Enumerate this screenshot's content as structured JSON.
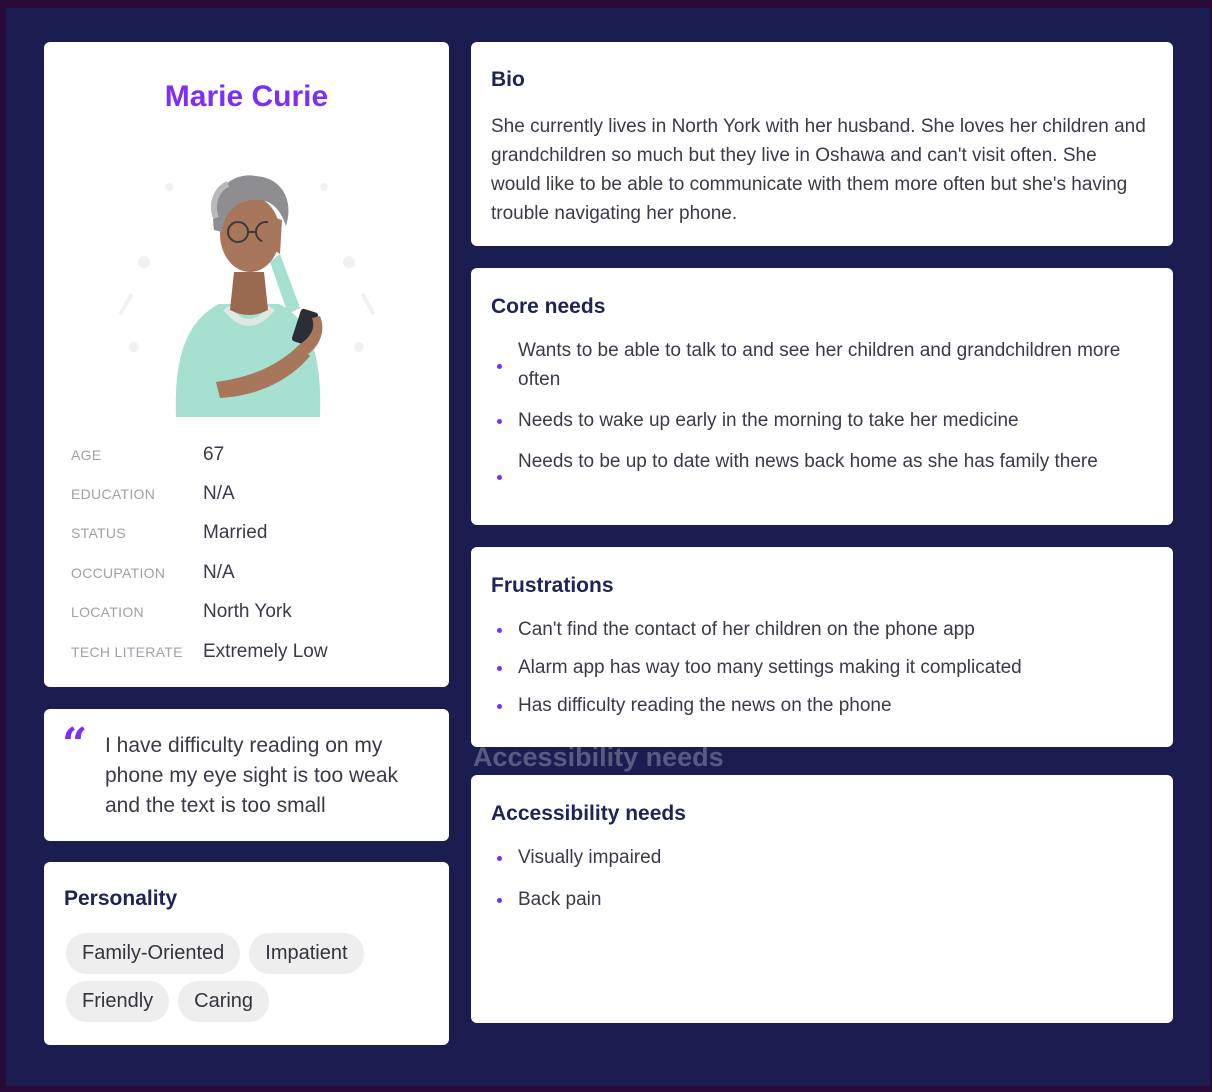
{
  "profile": {
    "name": "Marie Curie",
    "info": [
      {
        "label": "AGE",
        "value": "67"
      },
      {
        "label": "EDUCATION",
        "value": "N/A"
      },
      {
        "label": "STATUS",
        "value": "Married"
      },
      {
        "label": "OCCUPATION",
        "value": "N/A"
      },
      {
        "label": "LOCATION",
        "value": "North York"
      },
      {
        "label": "TECH LITERATE",
        "value": "Extremely Low"
      }
    ]
  },
  "quote": {
    "mark": "“",
    "text": "I have difficulty reading on my phone my eye sight is too weak and the text is too small"
  },
  "personality": {
    "title": "Personality",
    "tags": [
      "Family-Oriented",
      "Impatient",
      "Friendly",
      "Caring"
    ]
  },
  "bio": {
    "title": "Bio",
    "text": "She currently lives in North York with her husband. She loves her children and grandchildren so much but they live in Oshawa and can't visit often. She would like to be able to communicate with them more often but she's having trouble navigating her phone."
  },
  "core_needs": {
    "title": "Core needs",
    "items": [
      "Wants to be able to talk to and see her children and grandchildren more often",
      "Needs to wake up early in the morning to take her medicine",
      "Needs to be up to date with news back home as she has family there"
    ]
  },
  "frustrations": {
    "title": "Frustrations",
    "items": [
      "Can't find the contact of her children on the phone app",
      "Alarm app has way too many settings making it complicated",
      "Has difficulty reading the news on the phone"
    ]
  },
  "accessibility": {
    "title": "Accessibility needs",
    "ghost_title": "Accessibility needs",
    "items": [
      "Visually impaired",
      "Back pain"
    ]
  },
  "colors": {
    "accent": "#7b2ff7",
    "background": "#1b1c4f",
    "heading": "#1e2358"
  }
}
